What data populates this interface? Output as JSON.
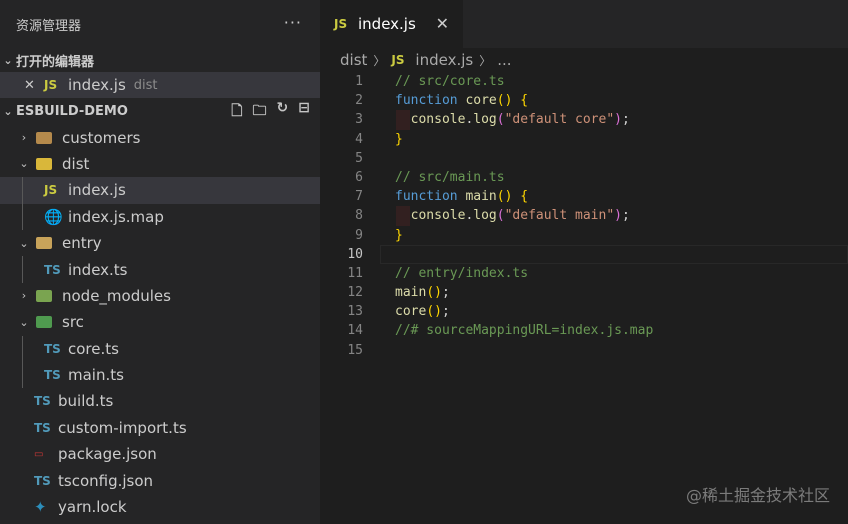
{
  "explorer": {
    "title": "资源管理器",
    "more": "···",
    "open_editors_label": "打开的编辑器",
    "open_editor": {
      "close": "✕",
      "badge": "JS",
      "name": "index.js",
      "dir": "dist"
    },
    "project_label": "ESBUILD-DEMO",
    "tree": [
      {
        "name": "customers",
        "type": "folder",
        "expanded": false
      },
      {
        "name": "dist",
        "type": "folder",
        "expanded": true
      },
      {
        "name": "index.js",
        "type": "js",
        "active": true
      },
      {
        "name": "index.js.map",
        "type": "map"
      },
      {
        "name": "entry",
        "type": "folder",
        "expanded": true
      },
      {
        "name": "index.ts",
        "type": "ts"
      },
      {
        "name": "node_modules",
        "type": "folder",
        "expanded": false
      },
      {
        "name": "src",
        "type": "folder",
        "expanded": true
      },
      {
        "name": "core.ts",
        "type": "ts"
      },
      {
        "name": "main.ts",
        "type": "ts"
      },
      {
        "name": "build.ts",
        "type": "ts"
      },
      {
        "name": "custom-import.ts",
        "type": "ts"
      },
      {
        "name": "package.json",
        "type": "json"
      },
      {
        "name": "tsconfig.json",
        "type": "ts"
      },
      {
        "name": "yarn.lock",
        "type": "yarn"
      }
    ]
  },
  "editor": {
    "tab": {
      "badge": "JS",
      "name": "index.js",
      "close": "✕"
    },
    "breadcrumb": {
      "folder": "dist",
      "badge": "JS",
      "file": "index.js",
      "tail": "..."
    },
    "current_line": 10,
    "lines": [
      [
        [
          "cm",
          "// src/core.ts"
        ]
      ],
      [
        [
          "kw",
          "function "
        ],
        [
          "fn",
          "core"
        ],
        [
          "br",
          "() {"
        ]
      ],
      [
        [
          "pl",
          "  "
        ],
        [
          "fn",
          "console"
        ],
        [
          "pl",
          "."
        ],
        [
          "fn",
          "log"
        ],
        [
          "br2",
          "("
        ],
        [
          "str",
          "\"default core\""
        ],
        [
          "br2",
          ")"
        ],
        [
          "pl",
          ";"
        ]
      ],
      [
        [
          "br",
          "}"
        ]
      ],
      [],
      [
        [
          "cm",
          "// src/main.ts"
        ]
      ],
      [
        [
          "kw",
          "function "
        ],
        [
          "fn",
          "main"
        ],
        [
          "br",
          "() {"
        ]
      ],
      [
        [
          "pl",
          "  "
        ],
        [
          "fn",
          "console"
        ],
        [
          "pl",
          "."
        ],
        [
          "fn",
          "log"
        ],
        [
          "br2",
          "("
        ],
        [
          "str",
          "\"default main\""
        ],
        [
          "br2",
          ")"
        ],
        [
          "pl",
          ";"
        ]
      ],
      [
        [
          "br",
          "}"
        ]
      ],
      [],
      [
        [
          "cm",
          "// entry/index.ts"
        ]
      ],
      [
        [
          "fn",
          "main"
        ],
        [
          "br",
          "()"
        ],
        [
          "pl",
          ";"
        ]
      ],
      [
        [
          "fn",
          "core"
        ],
        [
          "br",
          "()"
        ],
        [
          "pl",
          ";"
        ]
      ],
      [
        [
          "cm",
          "//# sourceMappingURL=index.js.map"
        ]
      ],
      []
    ]
  },
  "watermark": "@稀土掘金技术社区"
}
